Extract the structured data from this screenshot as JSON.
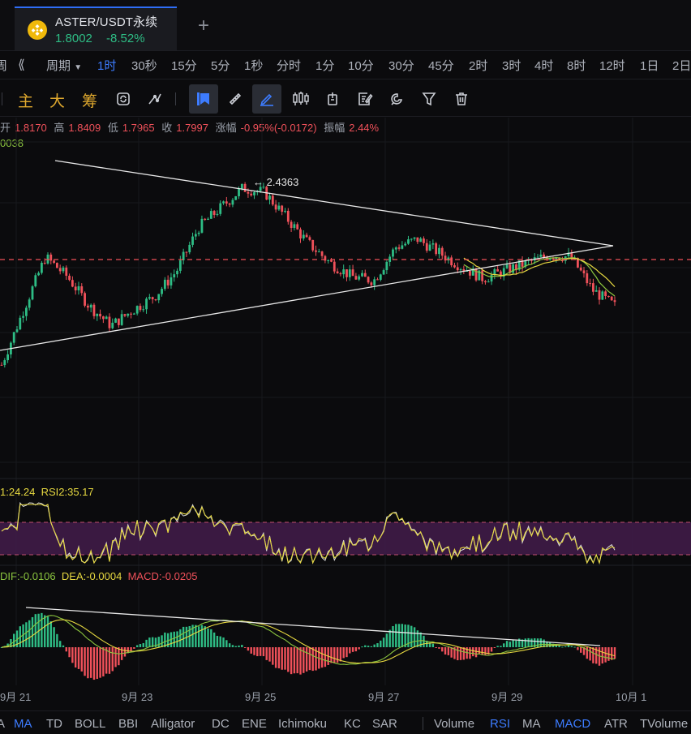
{
  "tab": {
    "symbol": "ASTER/USDT永续",
    "price": "1.8002",
    "change": "-8.52%",
    "new_tab_symbol": "+"
  },
  "intervals": {
    "left_fragment": "周",
    "collapse_symbol": "⟪",
    "period_label": "周期",
    "items": [
      "1时",
      "30秒",
      "15分",
      "5分",
      "1秒",
      "分时",
      "1分",
      "10分",
      "30分",
      "45分",
      "2时",
      "3时",
      "4时",
      "8时",
      "12时",
      "1日",
      "2日"
    ],
    "active": "1时"
  },
  "toolbar": {
    "main": "主",
    "big": "大",
    "chips": "筹",
    "icons": [
      "sync-icon",
      "line-tool-icon",
      "marker-icon",
      "ruler-icon",
      "pencil-icon",
      "candles-icon",
      "position-icon",
      "note-icon",
      "magnet-icon",
      "filter-icon",
      "trash-icon"
    ]
  },
  "ohlc": {
    "open_label": "开",
    "open": "1.8170",
    "high_label": "高",
    "high": "1.8409",
    "low_label": "低",
    "low": "1.7965",
    "close_label": "收",
    "close": "1.7997",
    "change_label": "涨幅",
    "change": "-0.95%(-0.0172)",
    "amp_label": "振幅",
    "amp": "2.44%",
    "ma_value": "0038"
  },
  "annotations": {
    "high_marker": "← 2.4363"
  },
  "rsi": {
    "rsi1": "1:24.24",
    "rsi2": "RSI2:35.17"
  },
  "macd": {
    "dif": "DIF:-0.0106",
    "dea": "DEA:-0.0004",
    "macd": "MACD:-0.0205"
  },
  "x_axis": {
    "labels": [
      "9月 21",
      "9月 23",
      "9月 25",
      "9月 27",
      "9月 29",
      "10月 1"
    ]
  },
  "indicators": {
    "items": [
      "A",
      "MA",
      "TD",
      "BOLL",
      "BBI",
      "Alligator",
      "DC",
      "ENE",
      "Ichimoku",
      "KC",
      "SAR",
      "Volume",
      "RSI",
      "MA",
      "MACD",
      "ATR",
      "TVolume"
    ],
    "active": [
      "MA",
      "RSI",
      "MACD"
    ]
  },
  "colors": {
    "up": "#2ebd85",
    "down": "#f0515a",
    "accent": "#3d7cff",
    "rsi_band": "#3d1a45",
    "rsi_line1": "#e6d840",
    "rsi_line2": "#d8d8d8",
    "ma_line": "#8cc63f",
    "trend_line": "#e8e8e8"
  },
  "chart_data": {
    "type": "candlestick",
    "symbol": "ASTER/USDT永续",
    "interval": "1时",
    "x_ticks": [
      "9月 21",
      "9月 23",
      "9月 25",
      "9月 27",
      "9月 29",
      "10月 1"
    ],
    "last_close": 1.7997,
    "period_high": 2.4363,
    "approx_close_path": [
      1.5,
      1.78,
      2.05,
      1.95,
      1.8,
      1.7,
      1.78,
      1.85,
      1.98,
      2.2,
      2.3,
      2.4,
      2.38,
      2.25,
      2.12,
      2.02,
      1.95,
      1.93,
      2.1,
      2.14,
      2.07,
      2.0,
      1.94,
      1.98,
      2.02,
      2.06,
      2.05,
      1.88,
      1.8
    ],
    "rsi_band": [
      30,
      70
    ],
    "macd_histogram_sign": [
      "+",
      "-",
      "+",
      "-",
      "+",
      "-",
      "+"
    ]
  }
}
